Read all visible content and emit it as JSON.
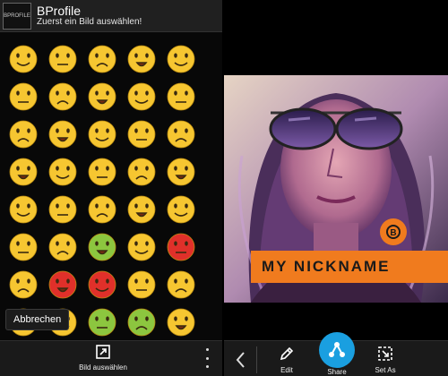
{
  "app": {
    "logo_text": "BPROFILE",
    "title": "BProfile",
    "subtitle": "Zuerst ein Bild auswählen!"
  },
  "emoji_grid": {
    "icons": [
      "smiling-face-icon",
      "happy-face-icon",
      "grinning-face-icon",
      "laughing-face-icon",
      "winking-tongue-face-icon",
      "hug-face-icon",
      "waving-face-icon",
      "party-face-icon",
      "sleepy-smile-face-icon",
      "hiding-face-icon",
      "kiss-heart-face-icon",
      "pouting-face-icon",
      "confused-face-icon",
      "neutral-face-icon",
      "unamused-face-icon",
      "shrug-face-icon",
      "heart-eyes-face-icon",
      "shy-face-icon",
      "sweat-face-icon",
      "worried-face-icon",
      "thinking-face-icon",
      "surprised-face-icon",
      "pondering-face-icon",
      "peeking-face-icon",
      "sad-face-icon",
      "tearful-face-icon",
      "shocked-face-icon",
      "nauseated-face-icon",
      "screaming-face-icon",
      "angry-red-face-icon",
      "grimacing-face-icon",
      "furious-face-icon",
      "rage-face-icon",
      "crying-face-icon",
      "annoyed-face-icon",
      "facepalm-face-icon",
      "frowning-face-icon",
      "sick-face-icon",
      "vomiting-face-icon",
      "dizzy-face-icon"
    ]
  },
  "dialog": {
    "cancel_label": "Abbrechen"
  },
  "left_toolbar": {
    "select_label": "Bild auswählen"
  },
  "preview": {
    "nickname": "MY NICKNAME",
    "badge_text": "B"
  },
  "right_toolbar": {
    "edit_label": "Edit",
    "share_label": "Share",
    "set_as_label": "Set As"
  },
  "colors": {
    "accent_orange": "#f07b1e",
    "share_blue": "#1a9fe0",
    "emoji_yellow": "#f6c631",
    "emoji_red": "#e0302a",
    "emoji_green": "#8cc63f"
  }
}
